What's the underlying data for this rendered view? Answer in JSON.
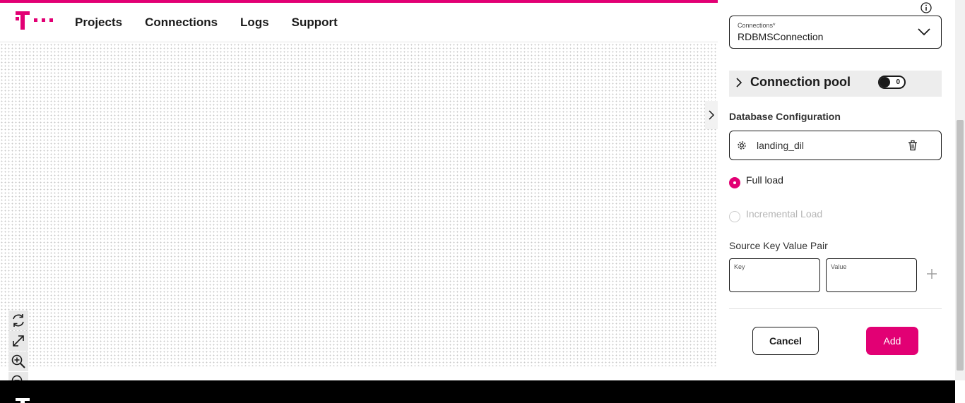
{
  "brand": {
    "accent_color": "#e20074",
    "logo_icon": "telekom-t-logo"
  },
  "nav": {
    "items": [
      {
        "label": "Projects"
      },
      {
        "label": "Connections"
      },
      {
        "label": "Logs"
      },
      {
        "label": "Support"
      }
    ]
  },
  "canvas_tools": [
    "refresh-icon",
    "fit-view-icon",
    "zoom-in-icon",
    "zoom-out-icon"
  ],
  "panel": {
    "connection_select": {
      "label": "Connections*",
      "value": "RDBMSConnection"
    },
    "connection_pool": {
      "title": "Connection pool",
      "toggle_value": "0",
      "toggle_on": false
    },
    "database_config": {
      "label": "Database Configuration",
      "value": "landing_dil"
    },
    "load_options": [
      {
        "label": "Full load",
        "checked": true,
        "enabled": true
      },
      {
        "label": "Incremental Load",
        "checked": false,
        "enabled": false
      }
    ],
    "source_kv": {
      "label": "Source Key Value Pair",
      "key_label": "Key",
      "value_label": "Value",
      "key_value": "",
      "value_value": ""
    },
    "actions": {
      "cancel_label": "Cancel",
      "add_label": "Add"
    }
  }
}
